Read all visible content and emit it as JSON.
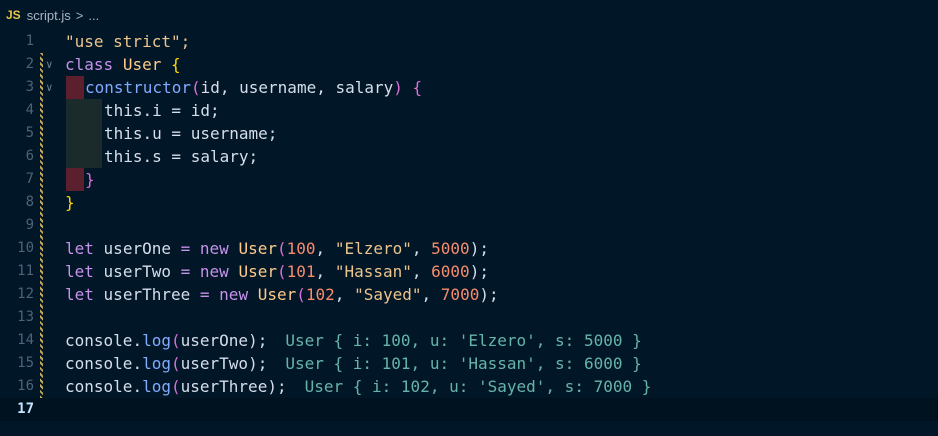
{
  "breadcrumb": {
    "icon_label": "JS",
    "file": "script.js",
    "sep": ">",
    "rest": "..."
  },
  "lines": [
    {
      "n": "1"
    },
    {
      "n": "2"
    },
    {
      "n": "3"
    },
    {
      "n": "4"
    },
    {
      "n": "5"
    },
    {
      "n": "6"
    },
    {
      "n": "7"
    },
    {
      "n": "8"
    },
    {
      "n": "9"
    },
    {
      "n": "10"
    },
    {
      "n": "11"
    },
    {
      "n": "12"
    },
    {
      "n": "13"
    },
    {
      "n": "14"
    },
    {
      "n": "15"
    },
    {
      "n": "16"
    },
    {
      "n": "17"
    }
  ],
  "code": {
    "l1": "\"use strict\";",
    "l2_kw": "class",
    "l2_name": "User",
    "l2_brace": "{",
    "l3_fn": "constructor",
    "l3_open": "(",
    "l3_params": "id, username, salary",
    "l3_close": ")",
    "l3_brace": "{",
    "l4": "this.i = id;",
    "l5": "this.u = username;",
    "l6": "this.s = salary;",
    "l7": "}",
    "l8": "}",
    "l10": {
      "kw": "let",
      "var": "userOne",
      "eq": "=",
      "new": "new",
      "cls": "User",
      "open": "(",
      "n": "100",
      "c1": ",",
      "s": "\"Elzero\"",
      "c2": ",",
      "sal": "5000",
      "close": ");"
    },
    "l11": {
      "kw": "let",
      "var": "userTwo",
      "eq": "=",
      "new": "new",
      "cls": "User",
      "open": "(",
      "n": "101",
      "c1": ",",
      "s": "\"Hassan\"",
      "c2": ",",
      "sal": "6000",
      "close": ");"
    },
    "l12": {
      "kw": "let",
      "var": "userThree",
      "eq": "=",
      "new": "new",
      "cls": "User",
      "open": "(",
      "n": "102",
      "c1": ",",
      "s": "\"Sayed\"",
      "c2": ",",
      "sal": "7000",
      "close": ");"
    },
    "l14": {
      "obj": "console",
      "dot": ".",
      "fn": "log",
      "open": "(",
      "arg": "userOne",
      "close": ");",
      "hint": "User { i: 100, u: 'Elzero', s: 5000 }"
    },
    "l15": {
      "obj": "console",
      "dot": ".",
      "fn": "log",
      "open": "(",
      "arg": "userTwo",
      "close": ");",
      "hint": "User { i: 101, u: 'Hassan', s: 6000 }"
    },
    "l16": {
      "obj": "console",
      "dot": ".",
      "fn": "log",
      "open": "(",
      "arg": "userThree",
      "close": ");",
      "hint": "User { i: 102, u: 'Sayed', s: 7000 }"
    }
  }
}
